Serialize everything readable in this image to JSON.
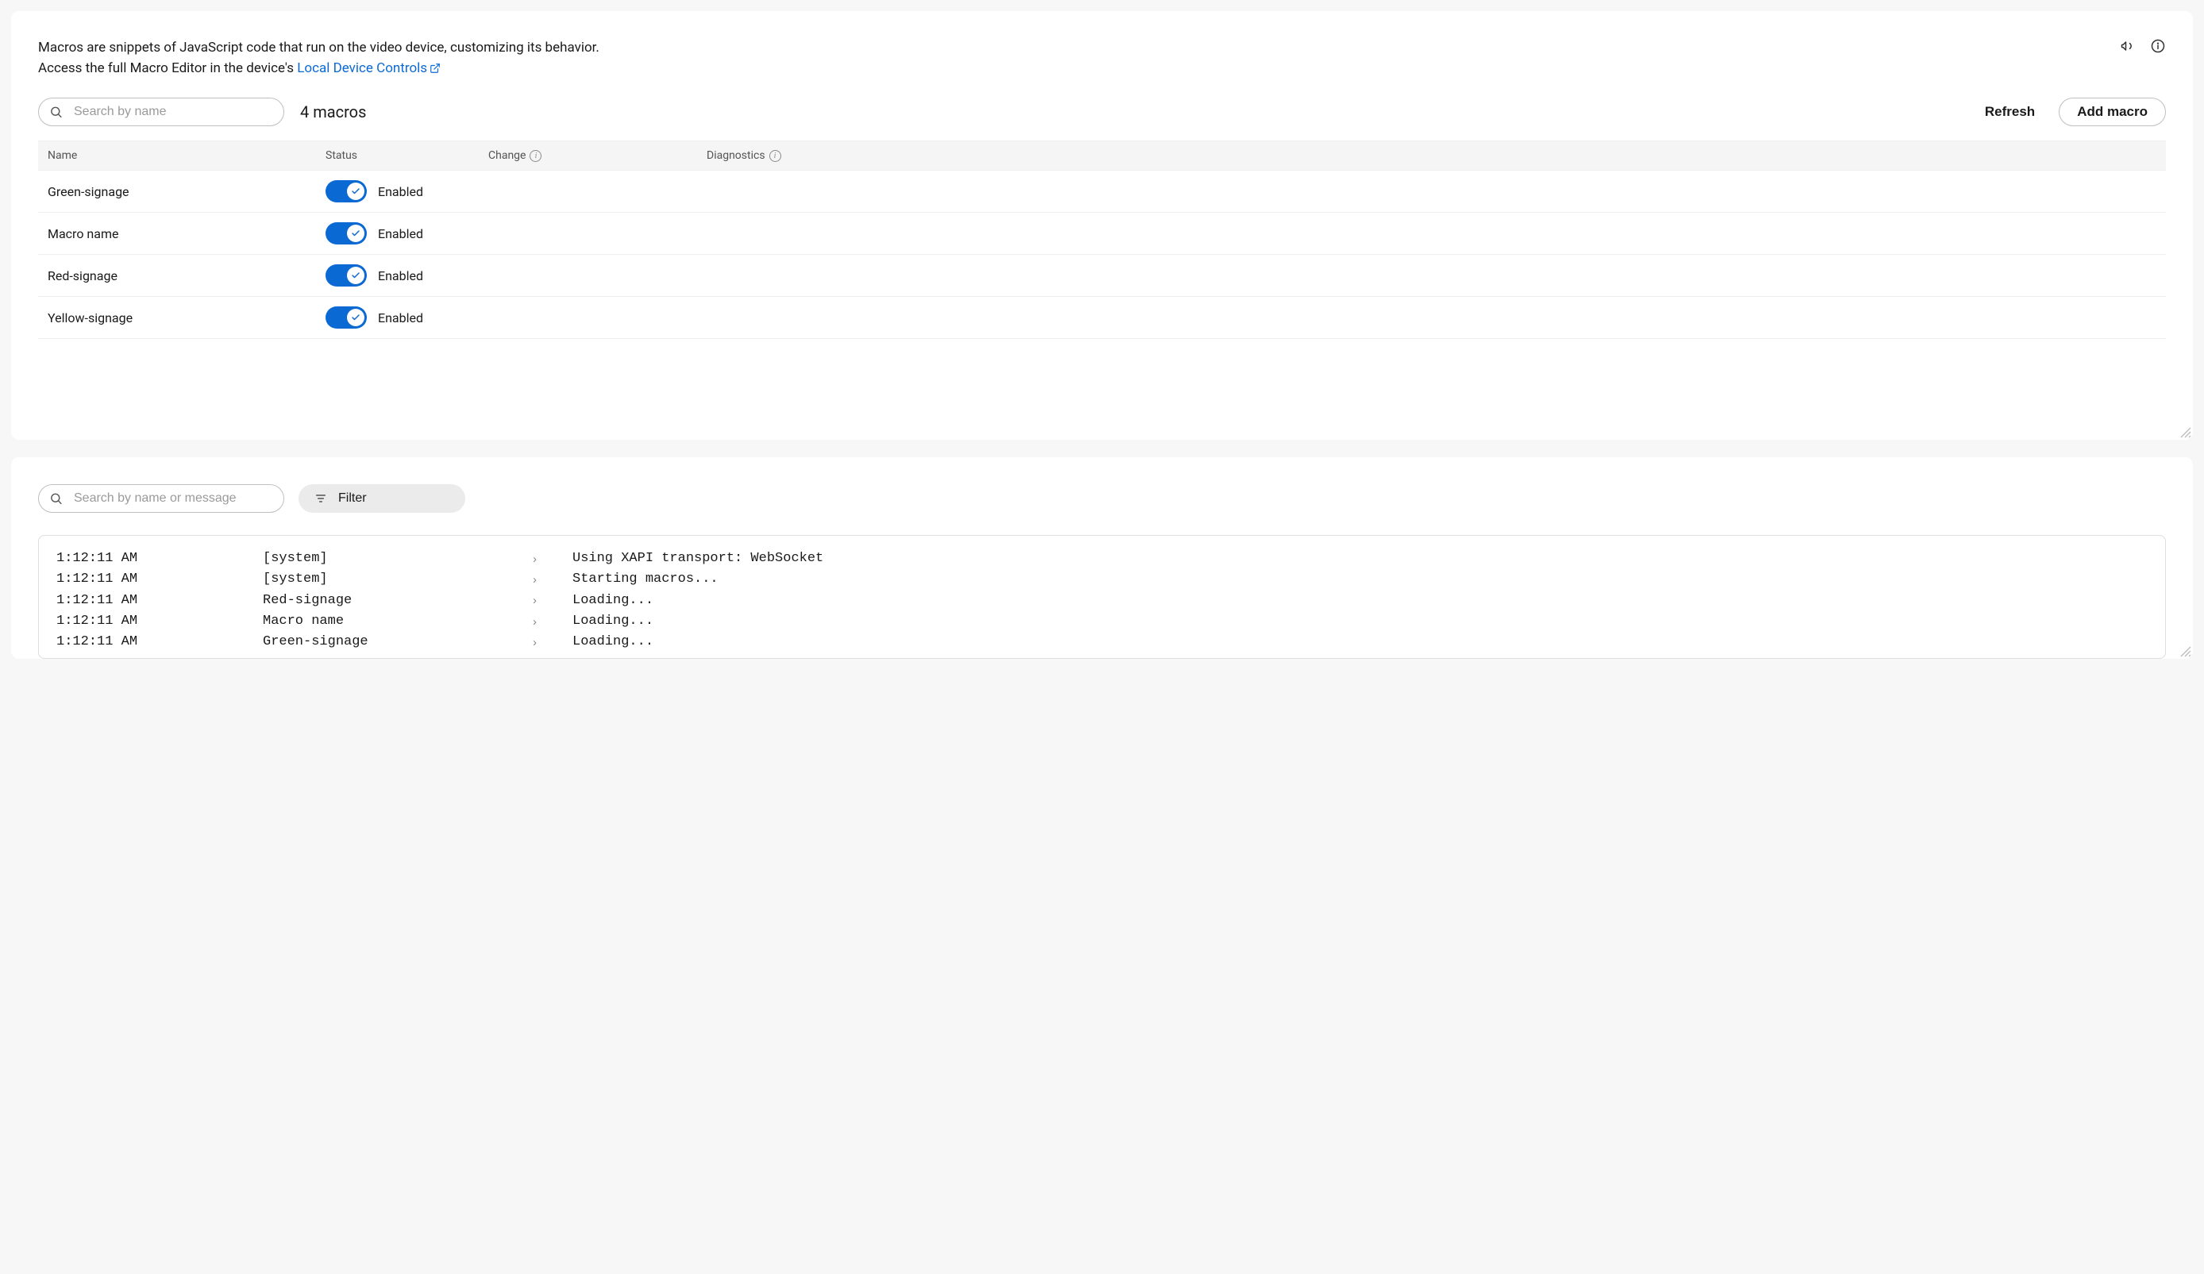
{
  "intro": {
    "line1": "Macros are snippets of JavaScript code that run on the video device, customizing its behavior.",
    "line2_prefix": "Access the full Macro Editor in the device's ",
    "link_text": "Local Device Controls"
  },
  "search": {
    "placeholder": "Search by name"
  },
  "count_label": "4 macros",
  "buttons": {
    "refresh": "Refresh",
    "add": "Add macro"
  },
  "table": {
    "headers": {
      "name": "Name",
      "status": "Status",
      "change": "Change",
      "diagnostics": "Diagnostics"
    },
    "rows": [
      {
        "name": "Green-signage",
        "status": "Enabled"
      },
      {
        "name": "Macro name",
        "status": "Enabled"
      },
      {
        "name": "Red-signage",
        "status": "Enabled"
      },
      {
        "name": "Yellow-signage",
        "status": "Enabled"
      }
    ]
  },
  "log_search": {
    "placeholder": "Search by name or message"
  },
  "filter_label": "Filter",
  "log": [
    {
      "time": "1:12:11 AM",
      "src": "[system]",
      "msg": "Using XAPI transport: WebSocket"
    },
    {
      "time": "1:12:11 AM",
      "src": "[system]",
      "msg": "Starting macros..."
    },
    {
      "time": "1:12:11 AM",
      "src": "Red-signage",
      "msg": "Loading..."
    },
    {
      "time": "1:12:11 AM",
      "src": "Macro name",
      "msg": "Loading..."
    },
    {
      "time": "1:12:11 AM",
      "src": "Green-signage",
      "msg": "Loading..."
    }
  ]
}
